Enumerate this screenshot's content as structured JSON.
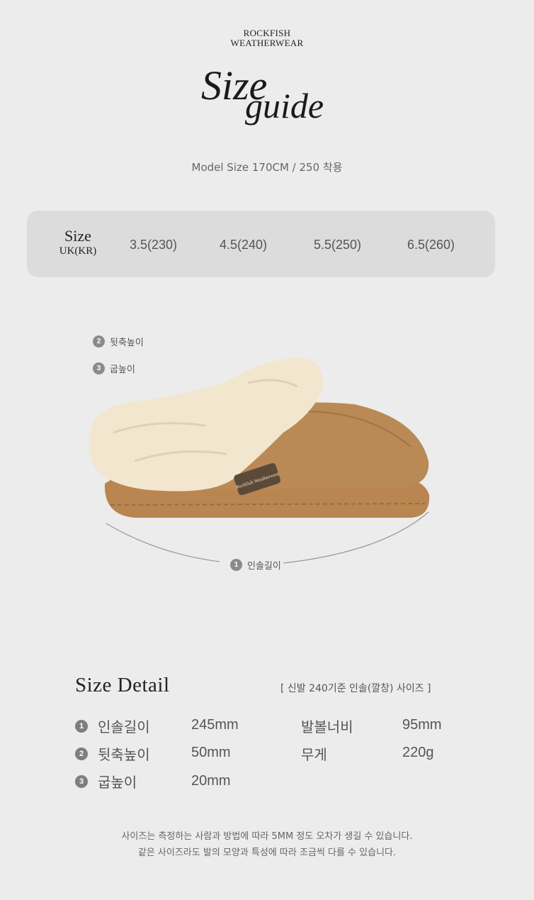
{
  "brand": {
    "line1": "ROCKFISH",
    "line2": "WEATHERWEAR"
  },
  "title": {
    "word1": "Size",
    "word2": "guide"
  },
  "model_size": "Model Size 170CM / 250 착용",
  "size_table": {
    "header_line1": "Size",
    "header_line2": "UK(KR)",
    "values": [
      "3.5(230)",
      "4.5(240)",
      "5.5(250)",
      "6.5(260)"
    ]
  },
  "diagram": {
    "markers": [
      {
        "num": "2",
        "label": "뒷축높이"
      },
      {
        "num": "3",
        "label": "굽높이"
      },
      {
        "num": "1",
        "label": "인솔길이"
      }
    ],
    "tag_text": "Rockfish Weatherwear"
  },
  "size_detail": {
    "title": "Size Detail",
    "note": "[ 신발 240기준 인솔(깔창) 사이즈 ]",
    "rows": [
      {
        "num": "1",
        "label": "인솔길이",
        "value": "245mm"
      },
      {
        "num": "2",
        "label": "뒷축높이",
        "value": "50mm"
      },
      {
        "num": "3",
        "label": "굽높이",
        "value": "20mm"
      }
    ],
    "extra": [
      {
        "label": "발볼너비",
        "value": "95mm"
      },
      {
        "label": "무게",
        "value": "220g"
      }
    ]
  },
  "footnote": {
    "line1": "사이즈는 측정하는 사람과 방법에 따라 5MM 정도 오차가 생길 수 있습니다.",
    "line2": "같은 사이즈라도 발의 모양과 특성에 따라 조금씩 다를 수 있습니다."
  },
  "colors": {
    "background": "#ececec",
    "bar": "#dcdcdc",
    "suede": "#b98a55",
    "fur": "#f3e6cf"
  }
}
